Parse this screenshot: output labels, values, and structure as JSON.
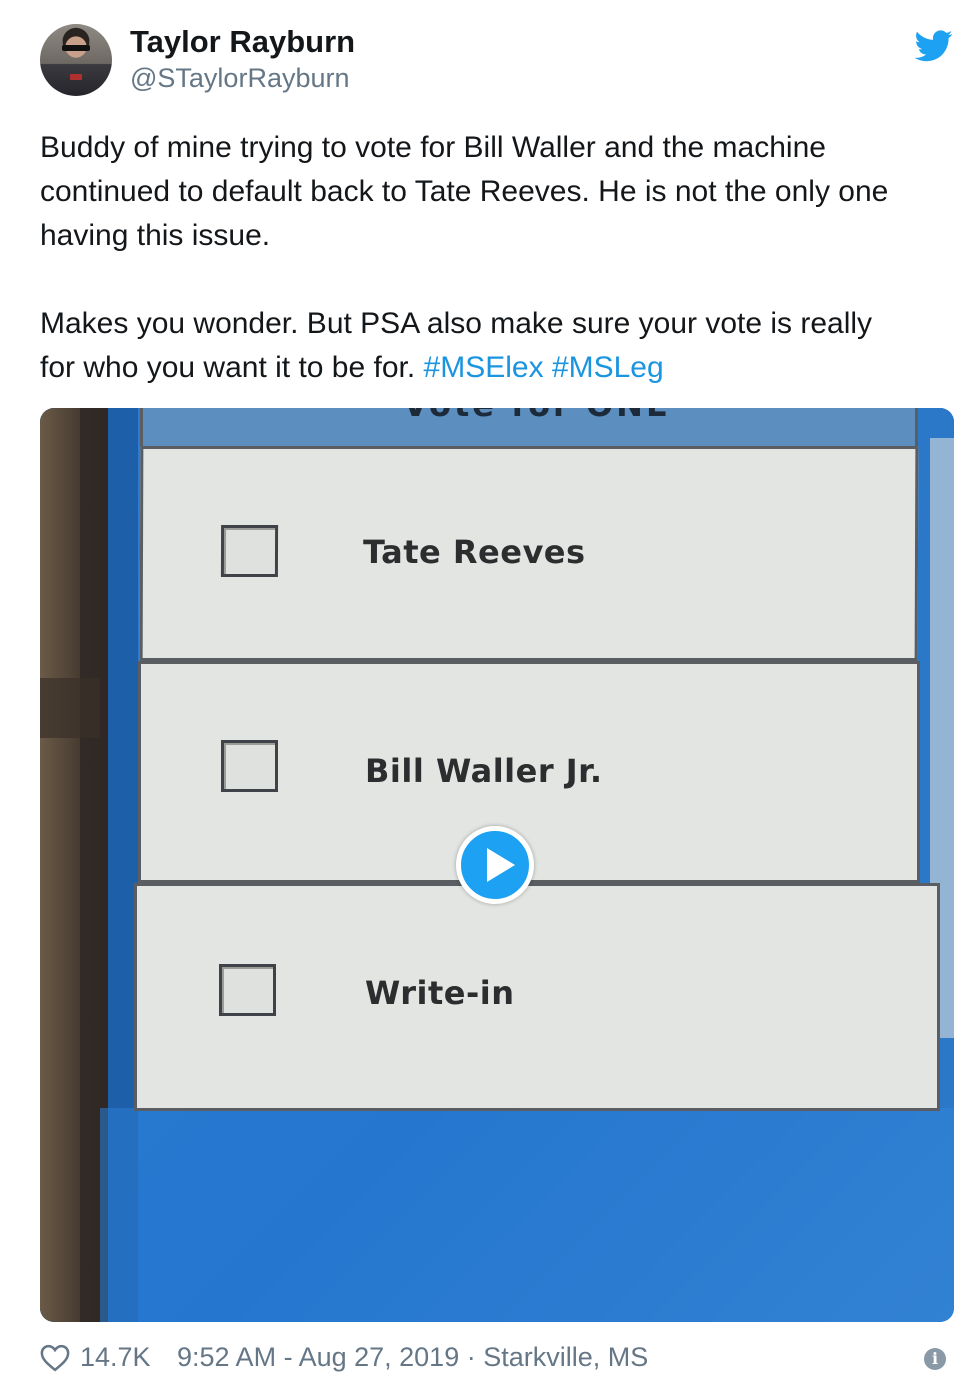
{
  "author": {
    "name": "Taylor Rayburn",
    "handle": "@STaylorRayburn"
  },
  "tweet": {
    "line1": "Buddy of mine trying to vote for Bill Waller and the machine",
    "line2": "continued to default back to Tate Reeves. He is not the only one",
    "line3": "having this issue.",
    "line4": "Makes you wonder.  But PSA also make sure your vote is really",
    "line5_text": "for who you want it to be for. ",
    "hashtag1": "#MSElex",
    "hashtag2": "#MSLeg"
  },
  "media": {
    "header_text": "Vote for ONE",
    "candidates": [
      "Tate Reeves",
      "Bill Waller Jr.",
      "Write-in"
    ],
    "play_icon": "play-icon"
  },
  "footer": {
    "likes": "14.7K",
    "timestamp": "9:52 AM - Aug 27, 2019 · Starkville, MS",
    "info_glyph": "i"
  },
  "colors": {
    "text": "#14171a",
    "secondary": "#657786",
    "link": "#1b95e0",
    "twitter_blue": "#1da1f2"
  }
}
